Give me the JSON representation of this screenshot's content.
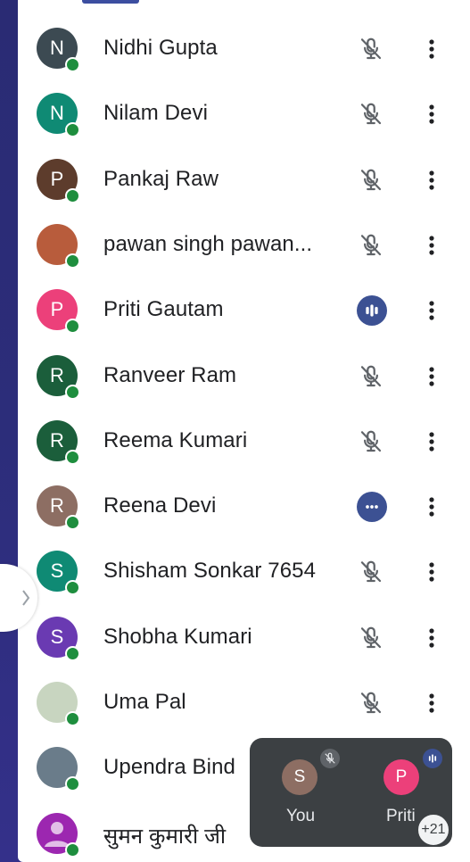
{
  "participants": [
    {
      "name": "Nidhi Gupta",
      "initial": "N",
      "avatar_color": "#3c4a52",
      "status": "muted"
    },
    {
      "name": "Nilam Devi",
      "initial": "N",
      "avatar_color": "#0f8a74",
      "status": "muted"
    },
    {
      "name": "Pankaj Raw",
      "initial": "P",
      "avatar_color": "#5d3c2c",
      "status": "muted"
    },
    {
      "name": "pawan singh pawan...",
      "initial": "",
      "avatar_color": "#b85c3c",
      "status": "muted"
    },
    {
      "name": "Priti Gautam",
      "initial": "P",
      "avatar_color": "#ec407a",
      "status": "speaking"
    },
    {
      "name": "Ranveer Ram",
      "initial": "R",
      "avatar_color": "#1b5e3b",
      "status": "muted"
    },
    {
      "name": "Reema Kumari",
      "initial": "R",
      "avatar_color": "#1b5e3b",
      "status": "muted"
    },
    {
      "name": "Reena Devi",
      "initial": "R",
      "avatar_color": "#8d6e63",
      "status": "options"
    },
    {
      "name": "Shisham Sonkar 7654",
      "initial": "S",
      "avatar_color": "#0f8a74",
      "status": "muted"
    },
    {
      "name": "Shobha Kumari",
      "initial": "S",
      "avatar_color": "#6a3ab2",
      "status": "muted"
    },
    {
      "name": "Uma Pal",
      "initial": "",
      "avatar_color": "#c8d5c0",
      "status": "muted"
    },
    {
      "name": "Upendra Bind",
      "initial": "",
      "avatar_color": "#6a7c8a",
      "status": "muted"
    },
    {
      "name": "सुमन कुमारी जी",
      "initial": "",
      "avatar_color": "#9c27b0",
      "status": "muted"
    }
  ],
  "floating_tiles": {
    "you": {
      "label": "You",
      "initial": "S",
      "color": "#8d6e63"
    },
    "other": {
      "label": "Priti",
      "initial": "P",
      "color": "#ec407a"
    },
    "more_count": "+21"
  },
  "colors": {
    "online": "#1e8e3e",
    "speaking": "#3c5193",
    "icon_grey": "#5f6368"
  }
}
